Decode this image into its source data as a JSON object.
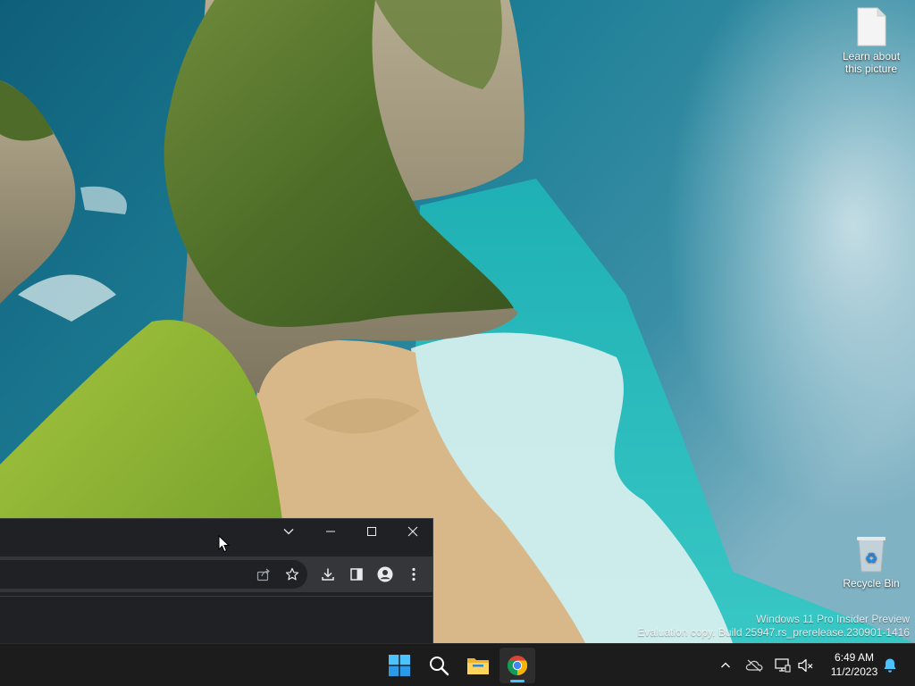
{
  "desktop": {
    "icons": [
      {
        "label": "Learn about this picture"
      },
      {
        "label": "Recycle Bin"
      }
    ],
    "watermark": {
      "line1": "Windows 11 Pro Insider Preview",
      "line2": "Evaluation copy. Build 25947.rs_prerelease.230901-1416"
    }
  },
  "taskbar": {
    "apps": [
      "start-icon",
      "search-icon",
      "file-explorer-icon",
      "chrome-icon"
    ],
    "clock": {
      "time": "6:49 AM",
      "date": "11/2/2023"
    },
    "tray": [
      "chevron-up-icon",
      "onedrive-icon",
      "network-icon",
      "volume-muted-icon",
      "notification-bell-icon"
    ]
  },
  "colors": {
    "taskbar_bg": "#1c1c1c",
    "browser_bg": "#202124",
    "toolbar_bg": "#35363a",
    "accent": "#4cc2ff",
    "windows_blue": "#0078d4"
  }
}
